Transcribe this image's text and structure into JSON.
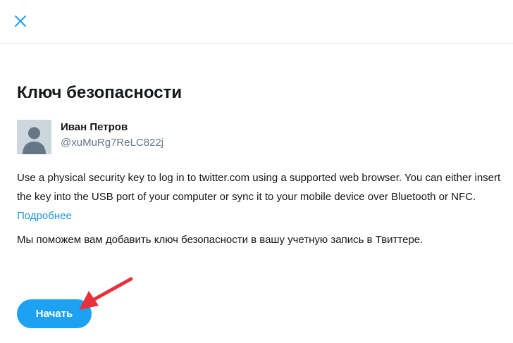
{
  "header": {
    "close_icon": "close-icon"
  },
  "main": {
    "title": "Ключ безопасности",
    "user": {
      "name": "Иван Петров",
      "handle": "@xuMuRg7ReLC822j",
      "avatar_icon": "default-avatar-icon"
    },
    "description": "Use a physical security key to log in to twitter.com using a supported web browser. You can either insert the key into the USB port of your computer or sync it to your mobile device over Bluetooth or NFC.",
    "learn_more_link": "Подробнее",
    "helper_text": "Мы поможем вам добавить ключ безопасности в вашу учетную запись в Твиттере.",
    "start_button": "Начать"
  },
  "annotation": {
    "arrow_icon": "red-arrow-icon",
    "arrow_color": "#e8303a"
  },
  "colors": {
    "accent": "#1da1f2",
    "link": "#1b95e0",
    "close_icon": "#1da1f2",
    "divider": "#e1e8ed",
    "avatar_bg": "#ccd6dd"
  }
}
